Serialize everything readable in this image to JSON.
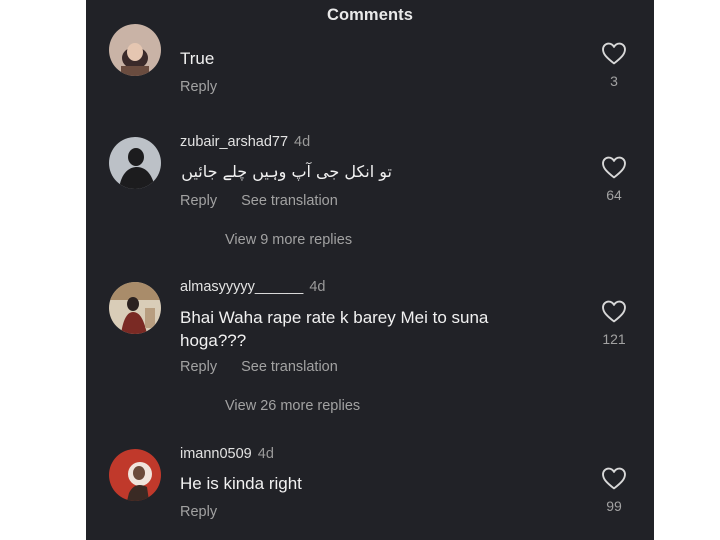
{
  "header": {
    "title": "Comments"
  },
  "comments": [
    {
      "username": "",
      "time": "",
      "text": "True",
      "reply_label": "Reply",
      "likes": "3"
    },
    {
      "username": "zubair_arshad77",
      "time": "4d",
      "text": "تو انکل جی آپ وہیں چلے جائیں",
      "reply_label": "Reply",
      "translation_label": "See translation",
      "likes": "64",
      "more_replies": "View 9 more replies"
    },
    {
      "username": "almasyyyyy______",
      "time": "4d",
      "text": "Bhai Waha rape rate k barey Mei to suna hoga???",
      "reply_label": "Reply",
      "translation_label": "See translation",
      "likes": "121",
      "more_replies": "View 26 more replies"
    },
    {
      "username": "imann0509",
      "time": "4d",
      "text": "He is kinda right",
      "reply_label": "Reply",
      "likes": "99"
    }
  ],
  "icons": {
    "like": "heart-outline-icon"
  },
  "colors": {
    "background": "#212227",
    "text": "#f1f1f1",
    "secondary_text": "#a2a2a2"
  }
}
